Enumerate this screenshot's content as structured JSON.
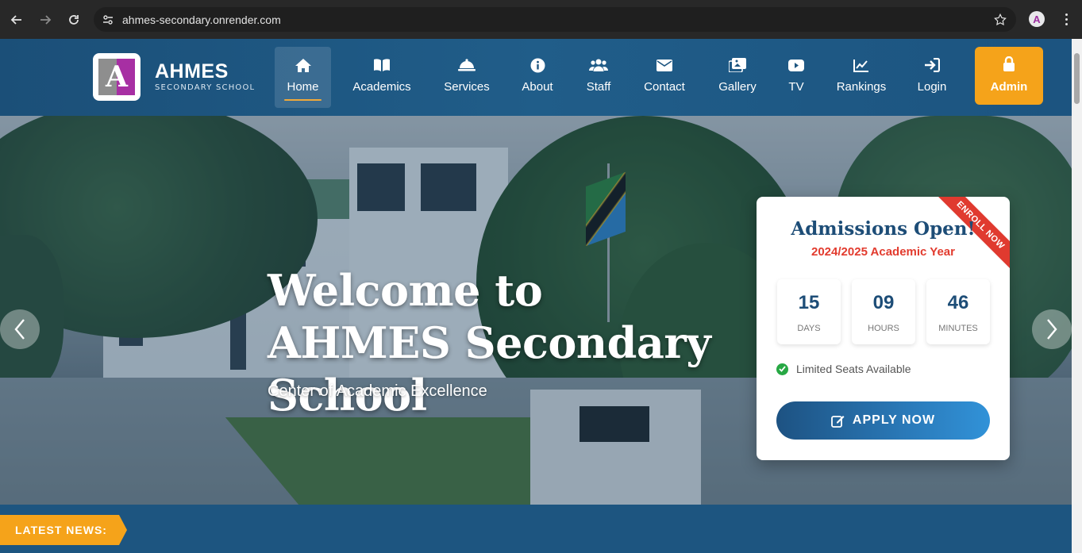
{
  "browser": {
    "url": "ahmes-secondary.onrender.com",
    "profile_initial": "A"
  },
  "brand": {
    "logo_letter": "A",
    "name": "AHMES",
    "subtitle": "SECONDARY SCHOOL"
  },
  "nav": {
    "items": [
      {
        "label": "Home",
        "icon": "home-icon"
      },
      {
        "label": "Academics",
        "icon": "book-icon"
      },
      {
        "label": "Services",
        "icon": "bell-service-icon"
      },
      {
        "label": "About",
        "icon": "info-icon"
      },
      {
        "label": "Staff",
        "icon": "users-icon"
      },
      {
        "label": "Contact",
        "icon": "envelope-icon"
      },
      {
        "label": "Gallery",
        "icon": "images-icon"
      },
      {
        "label": "TV",
        "icon": "youtube-icon"
      },
      {
        "label": "Rankings",
        "icon": "chart-line-icon"
      },
      {
        "label": "Login",
        "icon": "sign-in-icon"
      }
    ],
    "admin_label": "Admin"
  },
  "hero": {
    "title": "Welcome to AHMES Secondary School",
    "subtitle": "Center of Academic Excellence"
  },
  "admission_card": {
    "ribbon": "ENROLL NOW",
    "title": "Admissions Open!",
    "year": "2024/2025 Academic Year",
    "countdown": [
      {
        "value": "15",
        "unit": "DAYS"
      },
      {
        "value": "09",
        "unit": "HOURS"
      },
      {
        "value": "46",
        "unit": "MINUTES"
      }
    ],
    "seats": "Limited Seats Available",
    "apply_label": "APPLY NOW"
  },
  "news": {
    "label": "LATEST NEWS:"
  },
  "colors": {
    "primary": "#1d5580",
    "accent": "#f5a31a",
    "ribbon": "#e03a2f",
    "success": "#27a844"
  }
}
